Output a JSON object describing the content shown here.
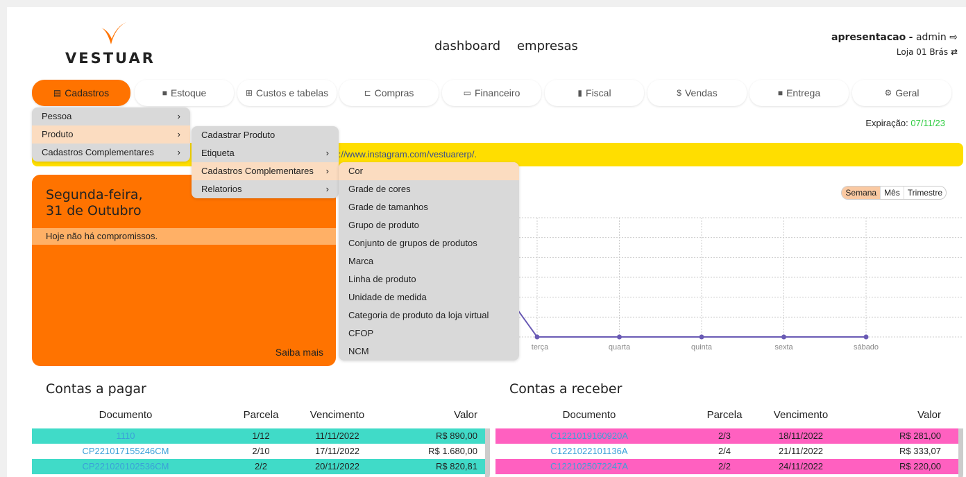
{
  "brand": {
    "name": "VESTUAR",
    "accent": "#ff7300",
    "logo_color": "#ff7300"
  },
  "topnav": [
    "dashboard",
    "empresas"
  ],
  "user": {
    "company": "apresentacao",
    "separator": "-",
    "role": "admin",
    "store": "Loja 01 Brás"
  },
  "tabs": [
    {
      "label": "Cadastros",
      "icon": "document-icon"
    },
    {
      "label": "Estoque",
      "icon": "truck-icon"
    },
    {
      "label": "Custos e tabelas",
      "icon": "table-icon"
    },
    {
      "label": "Compras",
      "icon": "cart-icon"
    },
    {
      "label": "Financeiro",
      "icon": "credit-card-icon"
    },
    {
      "label": "Fiscal",
      "icon": "file-icon"
    },
    {
      "label": "Vendas",
      "icon": "dollar-icon"
    },
    {
      "label": "Entrega",
      "icon": "truck-icon"
    },
    {
      "label": "Geral",
      "icon": "gears-icon"
    }
  ],
  "expiration": {
    "label": "Expiração:",
    "date": "07/11/23"
  },
  "banner": {
    "text": "ps://www.instagram.com/vestuarerp/."
  },
  "agenda": {
    "weekday": "Segunda-feira,",
    "date": "31 de Outubro",
    "message": "Hoje não há compromissos.",
    "more": "Saiba mais"
  },
  "periods": [
    "Semana",
    "Mês",
    "Trimestre"
  ],
  "menu_level1": [
    "Pessoa",
    "Produto",
    "Cadastros Complementares"
  ],
  "menu_level2": [
    "Cadastrar Produto",
    "Etiqueta",
    "Cadastros Complementares",
    "Relatorios"
  ],
  "menu_level3": [
    "Cor",
    "Grade de cores",
    "Grade de tamanhos",
    "Grupo de produto",
    "Conjunto de grupos de produtos",
    "Marca",
    "Linha de produto",
    "Unidade de medida",
    "Categoria de produto da loja virtual",
    "CFOP",
    "NCM"
  ],
  "chart_data": {
    "type": "line",
    "categories": [
      "terça",
      "quarta",
      "quinta",
      "sexta",
      "sábado"
    ],
    "values": [
      0,
      0,
      0,
      0,
      0
    ],
    "color": "#6a5bb5"
  },
  "payables": {
    "title": "Contas a pagar",
    "headers": [
      "Documento",
      "Parcela",
      "Vencimento",
      "Valor"
    ],
    "rows": [
      [
        "1110",
        "1/12",
        "11/11/2022",
        "R$ 890,00"
      ],
      [
        "CP221017155246CM",
        "2/10",
        "17/11/2022",
        "R$ 1.680,00"
      ],
      [
        "CP221020102536CM",
        "2/2",
        "20/11/2022",
        "R$ 820,81"
      ]
    ],
    "highlight": "#40dbc8"
  },
  "receivables": {
    "title": "Contas a receber",
    "headers": [
      "Documento",
      "Parcela",
      "Vencimento",
      "Valor"
    ],
    "rows": [
      [
        "C1221019160920A",
        "2/3",
        "18/11/2022",
        "R$ 281,00"
      ],
      [
        "C1221022101136A",
        "2/4",
        "21/11/2022",
        "R$ 333,07"
      ],
      [
        "C1221025072247A",
        "2/2",
        "24/11/2022",
        "R$ 220,00"
      ]
    ],
    "highlight": "#ff60c0"
  }
}
